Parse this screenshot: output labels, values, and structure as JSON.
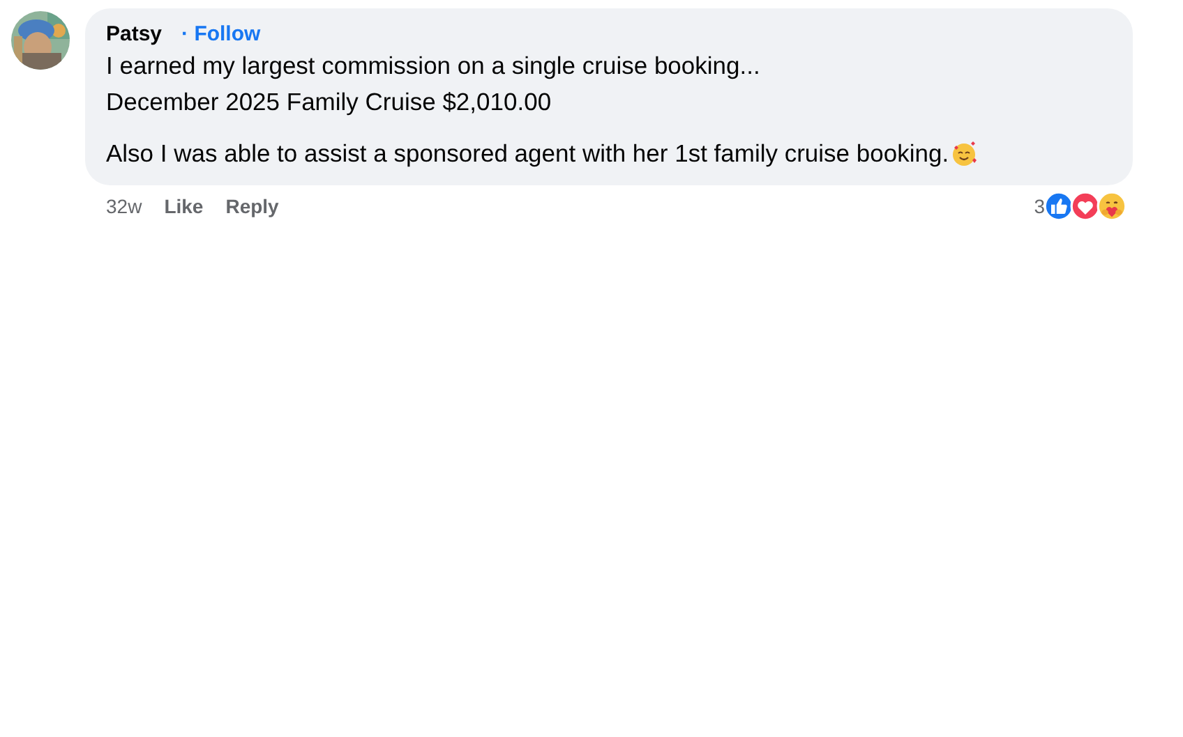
{
  "comment": {
    "author": "Patsy",
    "follow": "· Follow",
    "paragraphs": [
      "I earned my largest commission on a single cruise booking...\nDecember 2025 Family Cruise $2,010.00",
      "Also I was able to assist a sponsored agent with her 1st family cruise booking."
    ],
    "ends_with_emoji": true,
    "time": "32w",
    "actions": [
      "Like",
      "Reply"
    ],
    "reaction_count": "3",
    "reactions": [
      {
        "kind": "like"
      },
      {
        "kind": "love"
      },
      {
        "kind": "care"
      }
    ]
  }
}
